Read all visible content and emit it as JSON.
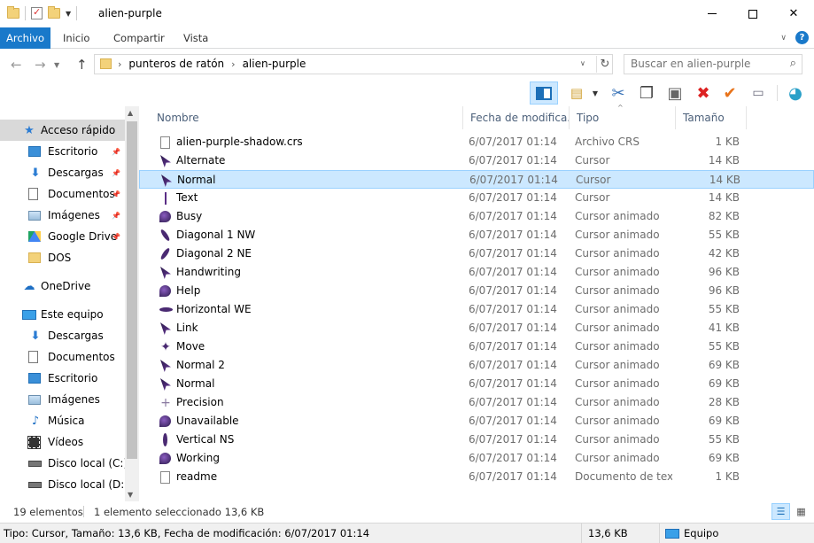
{
  "window": {
    "title": "alien-purple",
    "controls": {
      "minimize": "minimize",
      "maximize": "maximize",
      "close": "close"
    }
  },
  "ribbon": {
    "tabs": [
      {
        "label": "Archivo",
        "active": true
      },
      {
        "label": "Inicio"
      },
      {
        "label": "Compartir"
      },
      {
        "label": "Vista"
      }
    ],
    "help": "?"
  },
  "address": {
    "path": [
      "punteros de ratón",
      "alien-purple"
    ]
  },
  "search": {
    "placeholder": "Buscar en alien-purple"
  },
  "navigation": {
    "items": [
      {
        "label": "Acceso rápido",
        "icon": "star-icon",
        "level": 1,
        "selected": true
      },
      {
        "label": "Escritorio",
        "icon": "desktop-icon",
        "level": 2,
        "pinned": true
      },
      {
        "label": "Descargas",
        "icon": "download-icon",
        "level": 2,
        "pinned": true
      },
      {
        "label": "Documentos",
        "icon": "document-icon",
        "level": 2,
        "pinned": true
      },
      {
        "label": "Imágenes",
        "icon": "image-icon",
        "level": 2,
        "pinned": true
      },
      {
        "label": "Google Drive",
        "icon": "google-drive-icon",
        "level": 2,
        "pinned": true
      },
      {
        "label": "DOS",
        "icon": "folder-icon",
        "level": 2
      },
      {
        "label": "OneDrive",
        "icon": "cloud-icon",
        "level": 1
      },
      {
        "label": "Este equipo",
        "icon": "computer-icon",
        "level": 1
      },
      {
        "label": "Descargas",
        "icon": "download-icon",
        "level": 2
      },
      {
        "label": "Documentos",
        "icon": "document-icon",
        "level": 2
      },
      {
        "label": "Escritorio",
        "icon": "desktop-icon",
        "level": 2
      },
      {
        "label": "Imágenes",
        "icon": "image-icon",
        "level": 2
      },
      {
        "label": "Música",
        "icon": "music-icon",
        "level": 2
      },
      {
        "label": "Vídeos",
        "icon": "video-icon",
        "level": 2
      },
      {
        "label": "Disco local (C:)",
        "icon": "disk-icon",
        "level": 2
      },
      {
        "label": "Disco local (D:)",
        "icon": "disk-icon",
        "level": 2
      }
    ]
  },
  "columns": {
    "name": "Nombre",
    "date": "Fecha de modifica...",
    "type": "Tipo",
    "size": "Tamaño"
  },
  "files": [
    {
      "name": "alien-purple-shadow.crs",
      "date": "6/07/2017 01:14",
      "type": "Archivo CRS",
      "size": "1 KB",
      "icon": "file-icon"
    },
    {
      "name": "Alternate",
      "date": "6/07/2017 01:14",
      "type": "Cursor",
      "size": "14 KB",
      "icon": "cursor-icon"
    },
    {
      "name": "Normal",
      "date": "6/07/2017 01:14",
      "type": "Cursor",
      "size": "14 KB",
      "icon": "cursor-icon",
      "selected": true
    },
    {
      "name": "Text",
      "date": "6/07/2017 01:14",
      "type": "Cursor",
      "size": "14 KB",
      "icon": "text-cursor-icon"
    },
    {
      "name": "Busy",
      "date": "6/07/2017 01:14",
      "type": "Cursor animado",
      "size": "82 KB",
      "icon": "busy-cursor-icon"
    },
    {
      "name": "Diagonal 1 NW",
      "date": "6/07/2017 01:14",
      "type": "Cursor animado",
      "size": "55 KB",
      "icon": "diagonal-nw-cursor-icon"
    },
    {
      "name": "Diagonal 2 NE",
      "date": "6/07/2017 01:14",
      "type": "Cursor animado",
      "size": "42 KB",
      "icon": "diagonal-ne-cursor-icon"
    },
    {
      "name": "Handwriting",
      "date": "6/07/2017 01:14",
      "type": "Cursor animado",
      "size": "96 KB",
      "icon": "cursor-icon"
    },
    {
      "name": "Help",
      "date": "6/07/2017 01:14",
      "type": "Cursor animado",
      "size": "96 KB",
      "icon": "busy-cursor-icon"
    },
    {
      "name": "Horizontal WE",
      "date": "6/07/2017 01:14",
      "type": "Cursor animado",
      "size": "55 KB",
      "icon": "horizontal-cursor-icon"
    },
    {
      "name": "Link",
      "date": "6/07/2017 01:14",
      "type": "Cursor animado",
      "size": "41 KB",
      "icon": "cursor-icon"
    },
    {
      "name": "Move",
      "date": "6/07/2017 01:14",
      "type": "Cursor animado",
      "size": "55 KB",
      "icon": "move-cursor-icon"
    },
    {
      "name": "Normal 2",
      "date": "6/07/2017 01:14",
      "type": "Cursor animado",
      "size": "69 KB",
      "icon": "cursor-icon"
    },
    {
      "name": "Normal",
      "date": "6/07/2017 01:14",
      "type": "Cursor animado",
      "size": "69 KB",
      "icon": "cursor-icon"
    },
    {
      "name": "Precision",
      "date": "6/07/2017 01:14",
      "type": "Cursor animado",
      "size": "28 KB",
      "icon": "precision-cursor-icon"
    },
    {
      "name": "Unavailable",
      "date": "6/07/2017 01:14",
      "type": "Cursor animado",
      "size": "69 KB",
      "icon": "busy-cursor-icon"
    },
    {
      "name": "Vertical NS",
      "date": "6/07/2017 01:14",
      "type": "Cursor animado",
      "size": "55 KB",
      "icon": "vertical-cursor-icon"
    },
    {
      "name": "Working",
      "date": "6/07/2017 01:14",
      "type": "Cursor animado",
      "size": "69 KB",
      "icon": "busy-cursor-icon"
    },
    {
      "name": "readme",
      "date": "6/07/2017 01:14",
      "type": "Documento de tex...",
      "size": "1 KB",
      "icon": "file-icon"
    }
  ],
  "statusbar": {
    "count": "19 elementos",
    "selection": "1 elemento seleccionado  13,6 KB"
  },
  "classic_status": {
    "info": "Tipo: Cursor, Tamaño: 13,6 KB, Fecha de modificación: 6/07/2017 01:14",
    "size": "13,6 KB",
    "location": "Equipo"
  },
  "colors": {
    "accent": "#1979ca",
    "selection_bg": "#cce8ff",
    "selection_border": "#99d1ff"
  }
}
